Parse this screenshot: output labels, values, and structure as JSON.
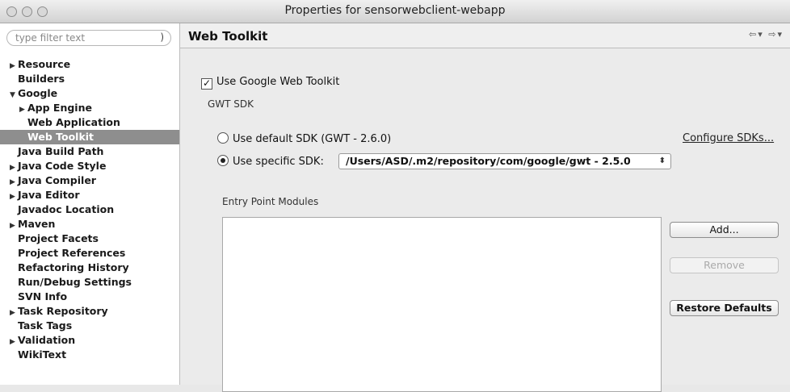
{
  "window": {
    "title": "Properties for sensorwebclient-webapp"
  },
  "sidebar": {
    "filter_placeholder": "type filter text",
    "items": [
      {
        "label": "Resource",
        "twisty": "▶",
        "indent": 0
      },
      {
        "label": "Builders",
        "twisty": "",
        "indent": 0
      },
      {
        "label": "Google",
        "twisty": "▼",
        "indent": 0
      },
      {
        "label": "App Engine",
        "twisty": "▶",
        "indent": 1
      },
      {
        "label": "Web Application",
        "twisty": "",
        "indent": 1
      },
      {
        "label": "Web Toolkit",
        "twisty": "",
        "indent": 1,
        "selected": true
      },
      {
        "label": "Java Build Path",
        "twisty": "",
        "indent": 0
      },
      {
        "label": "Java Code Style",
        "twisty": "▶",
        "indent": 0
      },
      {
        "label": "Java Compiler",
        "twisty": "▶",
        "indent": 0
      },
      {
        "label": "Java Editor",
        "twisty": "▶",
        "indent": 0
      },
      {
        "label": "Javadoc Location",
        "twisty": "",
        "indent": 0
      },
      {
        "label": "Maven",
        "twisty": "▶",
        "indent": 0
      },
      {
        "label": "Project Facets",
        "twisty": "",
        "indent": 0
      },
      {
        "label": "Project References",
        "twisty": "",
        "indent": 0
      },
      {
        "label": "Refactoring History",
        "twisty": "",
        "indent": 0
      },
      {
        "label": "Run/Debug Settings",
        "twisty": "",
        "indent": 0
      },
      {
        "label": "SVN Info",
        "twisty": "",
        "indent": 0
      },
      {
        "label": "Task Repository",
        "twisty": "▶",
        "indent": 0
      },
      {
        "label": "Task Tags",
        "twisty": "",
        "indent": 0
      },
      {
        "label": "Validation",
        "twisty": "▶",
        "indent": 0
      },
      {
        "label": "WikiText",
        "twisty": "",
        "indent": 0
      }
    ]
  },
  "main": {
    "title": "Web Toolkit",
    "use_gwt_label": "Use Google Web Toolkit",
    "gwt_sdk_label": "GWT SDK",
    "default_sdk_label": "Use default SDK (GWT - 2.6.0)",
    "specific_sdk_label": "Use specific SDK:",
    "specific_sdk_value": "/Users/ASD/.m2/repository/com/google/gwt - 2.5.0",
    "configure_link": "Configure SDKs...",
    "entry_points_label": "Entry Point Modules",
    "add_button": "Add...",
    "remove_button": "Remove",
    "restore_button": "Restore Defaults"
  }
}
